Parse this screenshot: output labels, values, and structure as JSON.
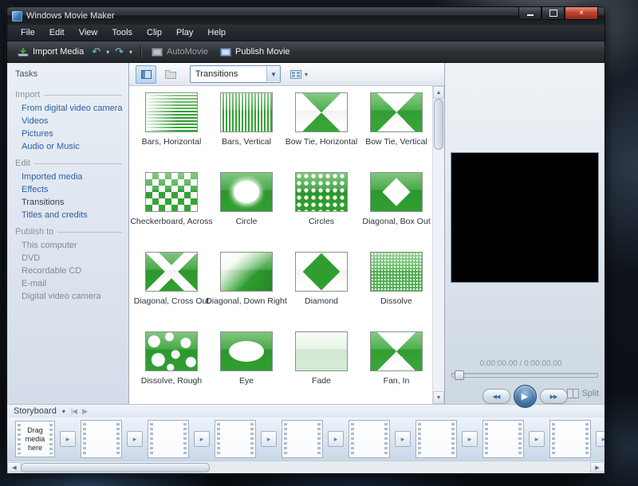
{
  "window": {
    "title": "Windows Movie Maker",
    "close_glyph": "×"
  },
  "menu": {
    "items": [
      "File",
      "Edit",
      "View",
      "Tools",
      "Clip",
      "Play",
      "Help"
    ]
  },
  "toolbar": {
    "import_media": "Import Media",
    "automovie": "AutoMovie",
    "publish_movie": "Publish Movie",
    "undo_glyph": "↶",
    "redo_glyph": "↷",
    "caret_glyph": "▾"
  },
  "tasks": {
    "title": "Tasks",
    "sections": [
      {
        "label": "Import",
        "items": [
          {
            "label": "From digital video camera",
            "state": "link"
          },
          {
            "label": "Videos",
            "state": "link"
          },
          {
            "label": "Pictures",
            "state": "link"
          },
          {
            "label": "Audio or Music",
            "state": "link"
          }
        ]
      },
      {
        "label": "Edit",
        "items": [
          {
            "label": "Imported media",
            "state": "link"
          },
          {
            "label": "Effects",
            "state": "link"
          },
          {
            "label": "Transitions",
            "state": "current"
          },
          {
            "label": "Titles and credits",
            "state": "link"
          }
        ]
      },
      {
        "label": "Publish to",
        "items": [
          {
            "label": "This computer",
            "state": "disabled"
          },
          {
            "label": "DVD",
            "state": "disabled"
          },
          {
            "label": "Recordable CD",
            "state": "disabled"
          },
          {
            "label": "E-mail",
            "state": "disabled"
          },
          {
            "label": "Digital video camera",
            "state": "disabled"
          }
        ]
      }
    ]
  },
  "content": {
    "view_selector": "Transitions",
    "transitions": [
      {
        "label": "Bars, Horizontal",
        "style": "bars-h"
      },
      {
        "label": "Bars, Vertical",
        "style": "bars-v"
      },
      {
        "label": "Bow Tie, Horizontal",
        "style": "bowtie-h"
      },
      {
        "label": "Bow Tie, Vertical",
        "style": "bowtie-v"
      },
      {
        "label": "Checkerboard, Across",
        "style": "checker"
      },
      {
        "label": "Circle",
        "style": "circle"
      },
      {
        "label": "Circles",
        "style": "circles"
      },
      {
        "label": "Diagonal, Box Out",
        "style": "boxout"
      },
      {
        "label": "Diagonal, Cross Out",
        "style": "crossout"
      },
      {
        "label": "Diagonal, Down Right",
        "style": "downright"
      },
      {
        "label": "Diamond",
        "style": "diamond"
      },
      {
        "label": "Dissolve",
        "style": "dissolve"
      },
      {
        "label": "Dissolve, Rough",
        "style": "dissolve-rough"
      },
      {
        "label": "Eye",
        "style": "eye"
      },
      {
        "label": "Fade",
        "style": "fade"
      },
      {
        "label": "Fan, In",
        "style": "fan-in"
      }
    ]
  },
  "preview": {
    "time": "0:00:00.00 / 0:00:00.00",
    "split_label": "Split",
    "prev_glyph": "◀◀",
    "play_glyph": "▶",
    "next_glyph": "▶▶"
  },
  "storyboard": {
    "label": "Storyboard",
    "caret_glyph": "▾",
    "nav_back_glyph": "|◀",
    "nav_fwd_glyph": "▶",
    "drag_hint": "Drag media here",
    "clip_slots": 9,
    "transition_glyph": "▸"
  }
}
